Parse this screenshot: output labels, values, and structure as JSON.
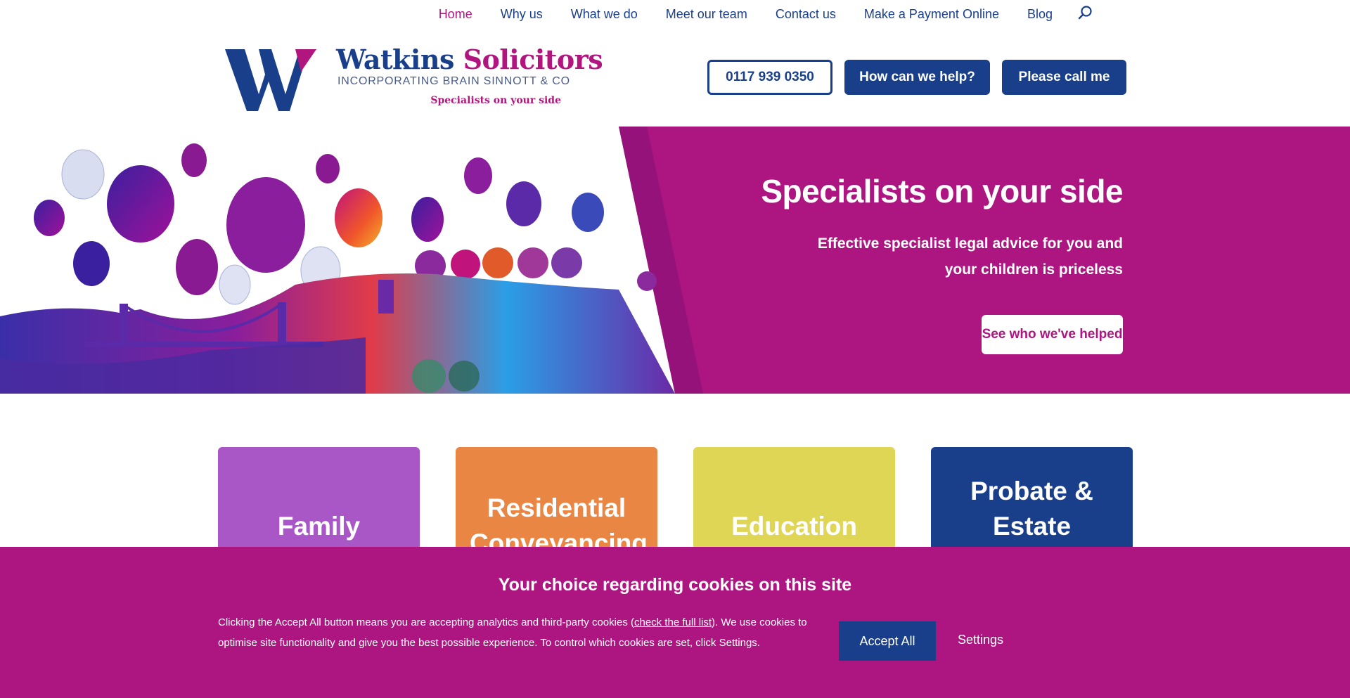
{
  "nav": {
    "items": [
      {
        "label": "Home",
        "active": true
      },
      {
        "label": "Why us"
      },
      {
        "label": "What we do"
      },
      {
        "label": "Meet our team"
      },
      {
        "label": "Contact us"
      },
      {
        "label": "Make a Payment Online"
      },
      {
        "label": "Blog"
      }
    ],
    "search_icon": "search-icon"
  },
  "logo": {
    "name_part1": "Watkins",
    "name_part2": "Solicitors",
    "subtitle": "INCORPORATING BRAIN SINNOTT & CO",
    "tagline": "Specialists on your side"
  },
  "header": {
    "phone": "0117 939 0350",
    "help_label": "How can we help?",
    "call_label": "Please call me"
  },
  "hero": {
    "title": "Specialists on your side",
    "subtitle": "Effective specialist legal advice for you and your children is priceless",
    "button_label": "See who we've helped"
  },
  "services": [
    {
      "label": "Family",
      "color": "#a957c6"
    },
    {
      "label": "Residential Conveyancing",
      "color": "#e98643"
    },
    {
      "label": "Education",
      "color": "#dfd656"
    },
    {
      "label": "Probate & Estate",
      "color": "#1a3f8a"
    }
  ],
  "cookie": {
    "title": "Your choice regarding cookies on this site",
    "text_before": "Clicking the Accept All button means you are accepting analytics and third-party cookies (",
    "link_label": "check the full list",
    "text_after": "). We use cookies to optimise site functionality and give you the best possible experience. To control which cookies are set, click Settings.",
    "accept_label": "Accept All",
    "settings_label": "Settings"
  },
  "colors": {
    "brand_blue": "#1a3f8a",
    "brand_magenta": "#ad1581"
  }
}
